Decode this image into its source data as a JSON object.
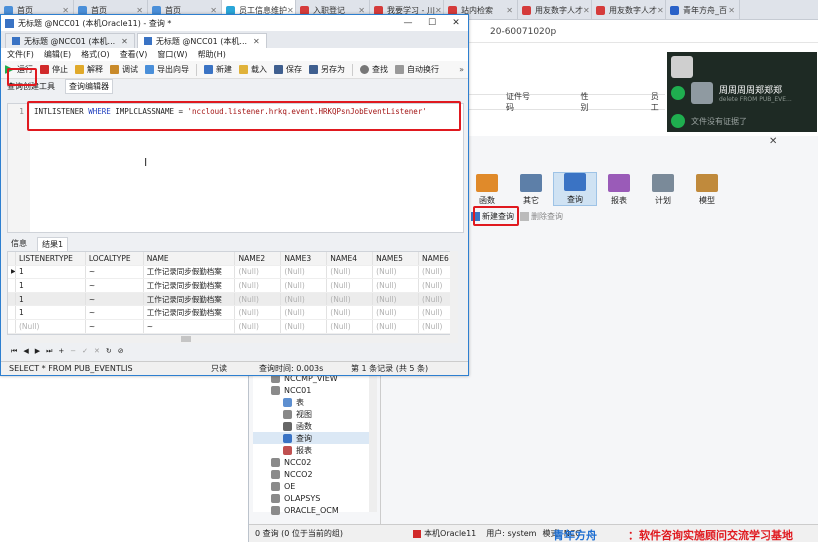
{
  "browser_tabs": [
    {
      "label": "首页",
      "color": "#4a8fd9"
    },
    {
      "label": "首页",
      "color": "#4a8fd9"
    },
    {
      "label": "首页",
      "color": "#4a8fd9"
    },
    {
      "label": "员工信息维护",
      "color": "#2aa6d8",
      "active": true
    },
    {
      "label": "入职登记",
      "color": "#d53b3b"
    },
    {
      "label": "我要学习 - 川",
      "color": "#d53b3b"
    },
    {
      "label": "站内检索",
      "color": "#d53b3b"
    },
    {
      "label": "用友数字人才",
      "color": "#d53b3b"
    },
    {
      "label": "用友数字人才",
      "color": "#d53b3b"
    },
    {
      "label": "青年方舟_百",
      "color": "#2a62c8"
    }
  ],
  "background": {
    "url_fragment": "20-60071020p",
    "col_headers": [
      "证件号码",
      "性别",
      "员工"
    ],
    "video": {
      "name": "周周周周郑郑郑",
      "sub": "delete FROM PUB_EVE...",
      "next": "文件没有证据了"
    },
    "ribbon": [
      {
        "label": "函数",
        "color": "#e08a2a"
      },
      {
        "label": "其它",
        "color": "#5d7fa8"
      },
      {
        "label": "查询",
        "color": "#3a73c4",
        "selected": true
      },
      {
        "label": "报表",
        "color": "#9a5bb8"
      },
      {
        "label": "计划",
        "color": "#7a8a99"
      },
      {
        "label": "模型",
        "color": "#c08a3c"
      }
    ],
    "subtool": {
      "new_query": "新建查询",
      "delete_query": "删除查询"
    },
    "tree": [
      {
        "label": "NCCMP_VIEW",
        "indent": 18,
        "color": "#8a8a8a"
      },
      {
        "label": "NCC01",
        "indent": 18,
        "color": "#8a8a8a"
      },
      {
        "label": "表",
        "indent": 30,
        "color": "#5d8fd0"
      },
      {
        "label": "视图",
        "indent": 30,
        "color": "#888888"
      },
      {
        "label": "函数",
        "indent": 30,
        "color": "#666666"
      },
      {
        "label": "查询",
        "indent": 30,
        "color": "#3a73c4",
        "selected": true
      },
      {
        "label": "报表",
        "indent": 30,
        "color": "#c05050"
      },
      {
        "label": "NCC02",
        "indent": 18,
        "color": "#8a8a8a"
      },
      {
        "label": "NCCO2",
        "indent": 18,
        "color": "#8a8a8a"
      },
      {
        "label": "OE",
        "indent": 18,
        "color": "#8a8a8a"
      },
      {
        "label": "OLAPSYS",
        "indent": 18,
        "color": "#8a8a8a"
      },
      {
        "label": "ORACLE_OCM",
        "indent": 18,
        "color": "#8a8a8a"
      }
    ],
    "status": {
      "count": "0 查询 (0 位于当前的组)",
      "conn": "本机Oracle11",
      "user": "用户: system",
      "mode": "模式: NCC"
    }
  },
  "query_window": {
    "title": "无标题 @NCC01 (本机Oracle11) - 查询 *",
    "doc_tabs": [
      {
        "label": "无标题 @NCC01 (本机...",
        "active": false
      },
      {
        "label": "无标题 @NCC01 (本机...",
        "active": true
      }
    ],
    "menu": [
      "文件(F)",
      "编辑(E)",
      "格式(O)",
      "查看(V)",
      "窗口(W)",
      "帮助(H)"
    ],
    "toolbar": {
      "run": "运行",
      "stop": "停止",
      "explain": "解释",
      "debug": "调试",
      "export": "导出向导",
      "new": "新建",
      "load": "载入",
      "save": "保存",
      "save_as": "另存为",
      "find": "查找",
      "wrap": "自动换行"
    },
    "subtabs": [
      "查询创建工具",
      "查询编辑器"
    ],
    "line_number": "1",
    "sql": {
      "part1": "INTLISTENER ",
      "kw1": "WHERE",
      "part2": " IMPLCLASSNAME = ",
      "str": "'nccloud.listener.hrkq.event.HRKQPsnJobEventListener'"
    },
    "result_tabs": [
      "信息",
      "结果1"
    ],
    "columns": [
      "LISTENERTYPE",
      "LOCALTYPE",
      "NAME",
      "NAME2",
      "NAME3",
      "NAME4",
      "NAME5",
      "NAME6"
    ],
    "rows": [
      [
        "1",
        "~",
        "工作记录同步假勤档案",
        "(Null)",
        "(Null)",
        "(Null)",
        "(Null)",
        "(Null)"
      ],
      [
        "1",
        "~",
        "工作记录同步假勤档案",
        "(Null)",
        "(Null)",
        "(Null)",
        "(Null)",
        "(Null)"
      ],
      [
        "1",
        "~",
        "工作记录同步假勤档案",
        "(Null)",
        "(Null)",
        "(Null)",
        "(Null)",
        "(Null)"
      ],
      [
        "1",
        "~",
        "工作记录同步假勤档案",
        "(Null)",
        "(Null)",
        "(Null)",
        "(Null)",
        "(Null)"
      ],
      [
        "(Null)",
        "~",
        "~",
        "(Null)",
        "(Null)",
        "(Null)",
        "(Null)",
        "(Null)"
      ]
    ],
    "status": {
      "sql": "SELECT * FROM PUB_EVENTLIS",
      "mode": "只读",
      "time": "查询时间: 0.003s",
      "records": "第 1 条记录 (共 5 条)"
    }
  },
  "watermark": {
    "blue": "青年方舟",
    "red": "：软件咨询实施顾问交流学习基地"
  },
  "colors": {
    "accent": "#2d7fd0",
    "highlight": "#e0191f"
  }
}
